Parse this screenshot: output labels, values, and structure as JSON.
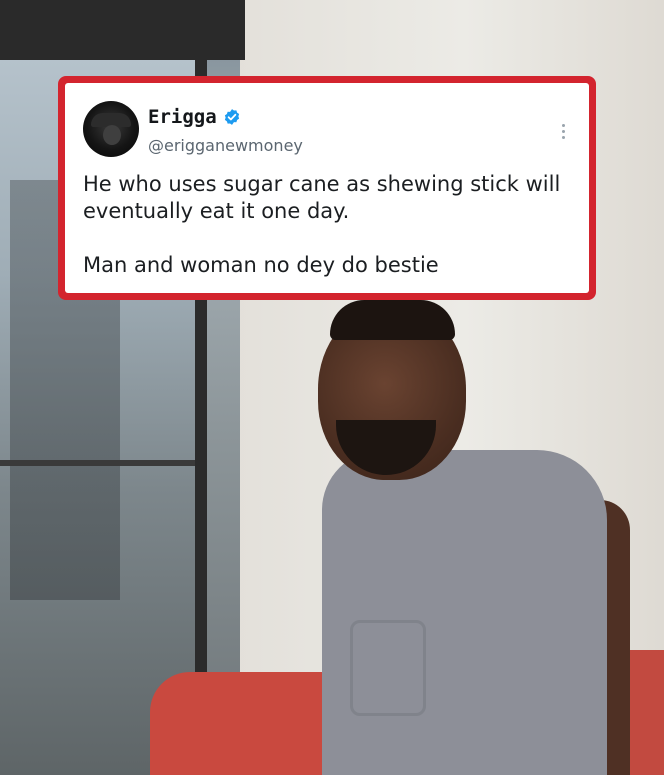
{
  "tweet": {
    "author_name": "Erigga",
    "handle": "@erigganewmoney",
    "line1": "He who uses sugar cane as shewing stick will eventually eat it one day.",
    "line2": "Man and woman no dey do bestie",
    "verified_icon": "verified-badge-icon",
    "more_icon": "more-options-icon"
  },
  "colors": {
    "card_border": "#d3242e",
    "verified": "#1d9bf0",
    "chair": "#c9493f",
    "shirt": "#8d8f98"
  }
}
